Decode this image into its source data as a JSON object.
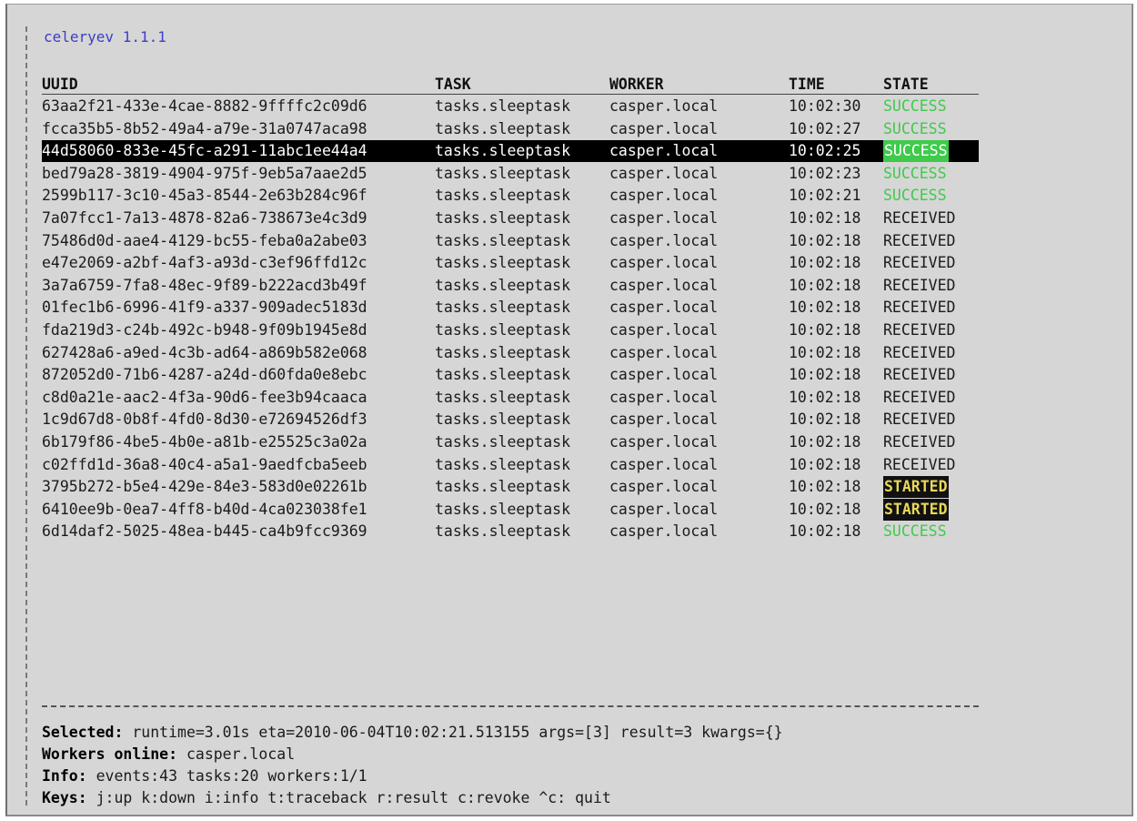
{
  "app": {
    "title": "celeryev 1.1.1"
  },
  "table": {
    "headers": {
      "uuid": "UUID",
      "task": "TASK",
      "worker": "WORKER",
      "time": "TIME",
      "state": "STATE"
    },
    "selected_index": 2,
    "rows": [
      {
        "uuid": "63aa2f21-433e-4cae-8882-9ffffc2c09d6",
        "task": "tasks.sleeptask",
        "worker": "casper.local",
        "time": "10:02:30",
        "state": "SUCCESS"
      },
      {
        "uuid": "fcca35b5-8b52-49a4-a79e-31a0747aca98",
        "task": "tasks.sleeptask",
        "worker": "casper.local",
        "time": "10:02:27",
        "state": "SUCCESS"
      },
      {
        "uuid": "44d58060-833e-45fc-a291-11abc1ee44a4",
        "task": "tasks.sleeptask",
        "worker": "casper.local",
        "time": "10:02:25",
        "state": "SUCCESS"
      },
      {
        "uuid": "bed79a28-3819-4904-975f-9eb5a7aae2d5",
        "task": "tasks.sleeptask",
        "worker": "casper.local",
        "time": "10:02:23",
        "state": "SUCCESS"
      },
      {
        "uuid": "2599b117-3c10-45a3-8544-2e63b284c96f",
        "task": "tasks.sleeptask",
        "worker": "casper.local",
        "time": "10:02:21",
        "state": "SUCCESS"
      },
      {
        "uuid": "7a07fcc1-7a13-4878-82a6-738673e4c3d9",
        "task": "tasks.sleeptask",
        "worker": "casper.local",
        "time": "10:02:18",
        "state": "RECEIVED"
      },
      {
        "uuid": "75486d0d-aae4-4129-bc55-feba0a2abe03",
        "task": "tasks.sleeptask",
        "worker": "casper.local",
        "time": "10:02:18",
        "state": "RECEIVED"
      },
      {
        "uuid": "e47e2069-a2bf-4af3-a93d-c3ef96ffd12c",
        "task": "tasks.sleeptask",
        "worker": "casper.local",
        "time": "10:02:18",
        "state": "RECEIVED"
      },
      {
        "uuid": "3a7a6759-7fa8-48ec-9f89-b222acd3b49f",
        "task": "tasks.sleeptask",
        "worker": "casper.local",
        "time": "10:02:18",
        "state": "RECEIVED"
      },
      {
        "uuid": "01fec1b6-6996-41f9-a337-909adec5183d",
        "task": "tasks.sleeptask",
        "worker": "casper.local",
        "time": "10:02:18",
        "state": "RECEIVED"
      },
      {
        "uuid": "fda219d3-c24b-492c-b948-9f09b1945e8d",
        "task": "tasks.sleeptask",
        "worker": "casper.local",
        "time": "10:02:18",
        "state": "RECEIVED"
      },
      {
        "uuid": "627428a6-a9ed-4c3b-ad64-a869b582e068",
        "task": "tasks.sleeptask",
        "worker": "casper.local",
        "time": "10:02:18",
        "state": "RECEIVED"
      },
      {
        "uuid": "872052d0-71b6-4287-a24d-d60fda0e8ebc",
        "task": "tasks.sleeptask",
        "worker": "casper.local",
        "time": "10:02:18",
        "state": "RECEIVED"
      },
      {
        "uuid": "c8d0a21e-aac2-4f3a-90d6-fee3b94caaca",
        "task": "tasks.sleeptask",
        "worker": "casper.local",
        "time": "10:02:18",
        "state": "RECEIVED"
      },
      {
        "uuid": "1c9d67d8-0b8f-4fd0-8d30-e72694526df3",
        "task": "tasks.sleeptask",
        "worker": "casper.local",
        "time": "10:02:18",
        "state": "RECEIVED"
      },
      {
        "uuid": "6b179f86-4be5-4b0e-a81b-e25525c3a02a",
        "task": "tasks.sleeptask",
        "worker": "casper.local",
        "time": "10:02:18",
        "state": "RECEIVED"
      },
      {
        "uuid": "c02ffd1d-36a8-40c4-a5a1-9aedfcba5eeb",
        "task": "tasks.sleeptask",
        "worker": "casper.local",
        "time": "10:02:18",
        "state": "RECEIVED"
      },
      {
        "uuid": "3795b272-b5e4-429e-84e3-583d0e02261b",
        "task": "tasks.sleeptask",
        "worker": "casper.local",
        "time": "10:02:18",
        "state": "STARTED"
      },
      {
        "uuid": "6410ee9b-0ea7-4ff8-b40d-4ca023038fe1",
        "task": "tasks.sleeptask",
        "worker": "casper.local",
        "time": "10:02:18",
        "state": "STARTED"
      },
      {
        "uuid": "6d14daf2-5025-48ea-b445-ca4b9fcc9369",
        "task": "tasks.sleeptask",
        "worker": "casper.local",
        "time": "10:02:18",
        "state": "SUCCESS"
      }
    ]
  },
  "footer": {
    "selected": {
      "label": "Selected:",
      "value": " runtime=3.01s eta=2010-06-04T10:02:21.513155 args=[3] result=3 kwargs={}"
    },
    "workers": {
      "label": "Workers online:",
      "value": " casper.local"
    },
    "info": {
      "label": "Info:",
      "value": " events:43 tasks:20 workers:1/1"
    },
    "keys": {
      "label": "Keys:",
      "value": " j:up k:down i:info t:traceback r:result c:revoke ^c: quit"
    }
  },
  "colors": {
    "background": "#d6d6d6",
    "title": "#3d3dc7",
    "success": "#3fca4c",
    "started_text": "#e8d65a",
    "selection": "#000000"
  }
}
